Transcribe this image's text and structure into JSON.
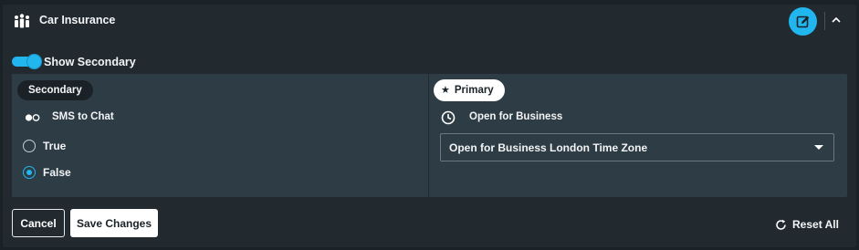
{
  "header": {
    "title": "Car Insurance",
    "icon": "people-group-icon",
    "edit_icon": "edit-icon",
    "collapse_icon": "chevron-up-icon"
  },
  "toggle": {
    "label": "Show Secondary",
    "on": true
  },
  "secondary": {
    "pill": "Secondary",
    "field_label": "SMS to Chat",
    "field_icon": "toggle-icon",
    "options": [
      {
        "label": "True",
        "selected": false
      },
      {
        "label": "False",
        "selected": true
      }
    ]
  },
  "primary": {
    "pill": "Primary",
    "pill_icon": "star-icon",
    "field_label": "Open for Business",
    "field_icon": "clock-icon",
    "select_value": "Open for Business London Time Zone"
  },
  "footer": {
    "cancel": "Cancel",
    "save": "Save Changes",
    "reset": "Reset All",
    "reset_icon": "refresh-icon"
  },
  "colors": {
    "accent": "#21b6ee",
    "panel": "#222a30",
    "column": "#2e3c45",
    "background": "#1b2227"
  }
}
